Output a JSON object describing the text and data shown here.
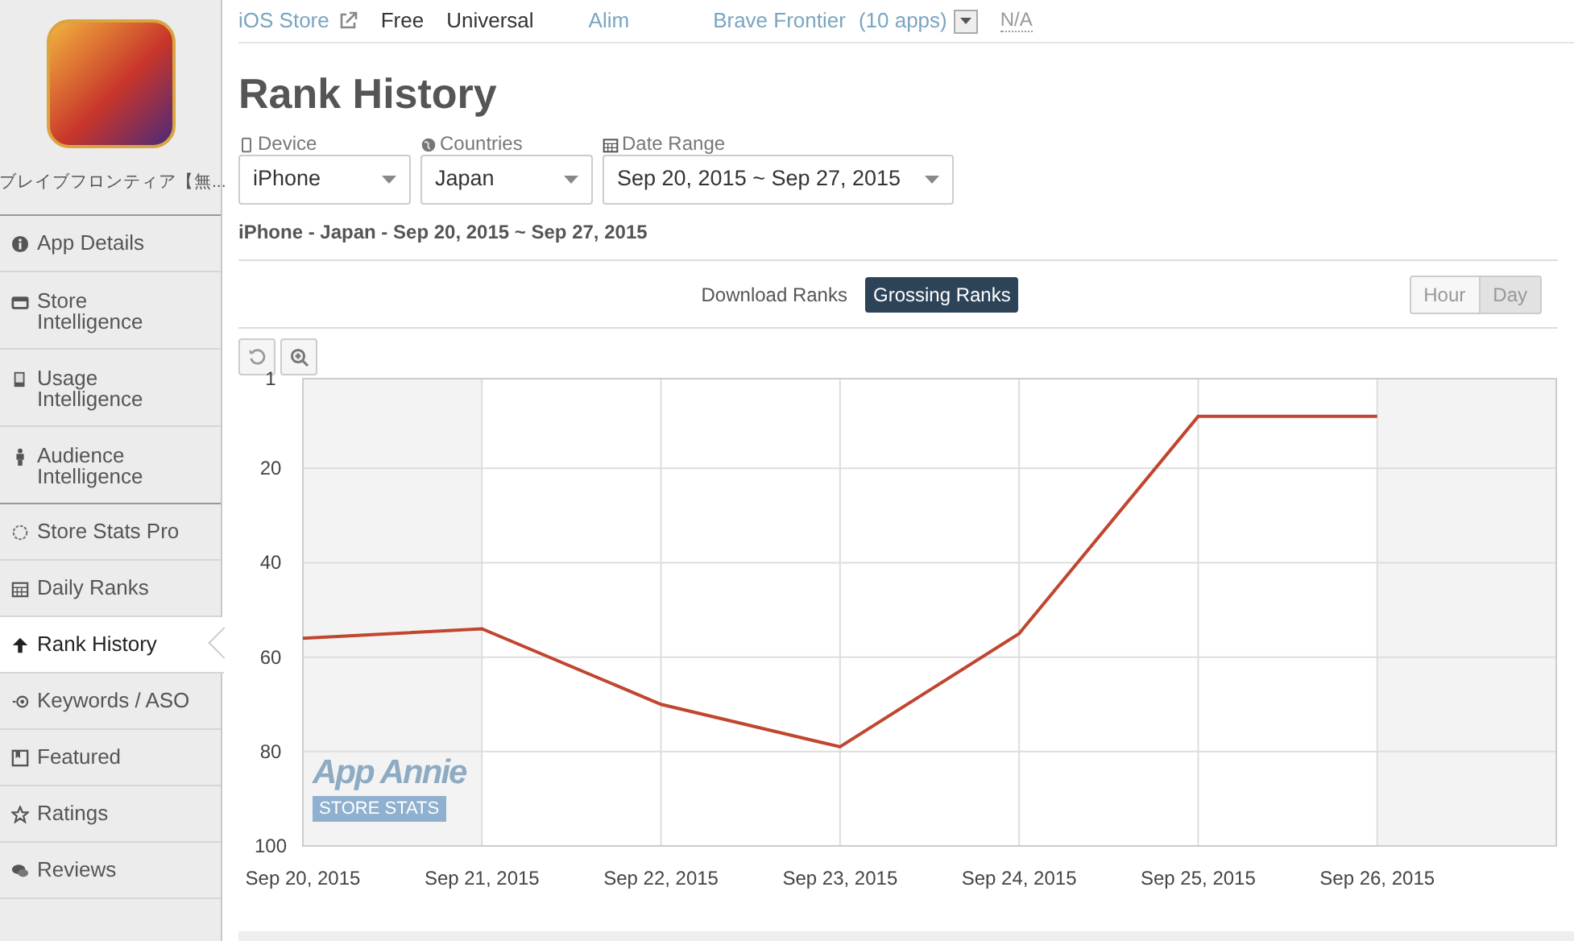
{
  "app": {
    "name": "ブレイブフロンティア【無..."
  },
  "sidebar": {
    "items": [
      {
        "label": "App Details",
        "selected": false
      },
      {
        "label": "Store Intelligence",
        "selected": false
      },
      {
        "label": "Usage Intelligence",
        "selected": false
      },
      {
        "label": "Audience Intelligence",
        "selected": false
      },
      {
        "label": "Store Stats Pro",
        "selected": false
      },
      {
        "label": "Daily Ranks",
        "selected": false
      },
      {
        "label": "Rank History",
        "selected": true
      },
      {
        "label": "Keywords / ASO",
        "selected": false
      },
      {
        "label": "Featured",
        "selected": false
      },
      {
        "label": "Ratings",
        "selected": false
      },
      {
        "label": "Reviews",
        "selected": false
      }
    ]
  },
  "top_bar": {
    "store": "iOS Store",
    "price": "Free",
    "device_support": "Universal",
    "company": "Alim",
    "publisher": "Brave Frontier",
    "app_count": "(10 apps)",
    "rating": "N/A"
  },
  "page_title": "Rank History",
  "filters": [
    {
      "label": "Device",
      "value": "iPhone"
    },
    {
      "label": "Countries",
      "value": "Japan"
    },
    {
      "label": "Date Range",
      "value": "Sep 20, 2015 ~ Sep 27, 2015"
    }
  ],
  "summary": "iPhone - Japan - Sep 20, 2015 ~ Sep 27, 2015",
  "rank_tabs": [
    {
      "label": "Download Ranks",
      "selected": false
    },
    {
      "label": "Grossing Ranks",
      "selected": true
    }
  ],
  "granularity": [
    {
      "label": "Hour",
      "selected": false
    },
    {
      "label": "Day",
      "selected": true
    }
  ],
  "chart_watermark": {
    "title": "App Annie",
    "subtitle": "STORE STATS"
  },
  "chart_data": {
    "type": "line",
    "categories": [
      "Sep 20, 2015",
      "Sep 21, 2015",
      "Sep 22, 2015",
      "Sep 23, 2015",
      "Sep 24, 2015",
      "Sep 25, 2015",
      "Sep 26, 2015"
    ],
    "series": [
      {
        "color": "#c0462f",
        "values": [
          56,
          54,
          70,
          79,
          55,
          9,
          9
        ]
      }
    ],
    "ylim": [
      100,
      1
    ],
    "yticks": [
      1,
      20,
      40,
      60,
      80,
      100
    ],
    "grid": true
  }
}
